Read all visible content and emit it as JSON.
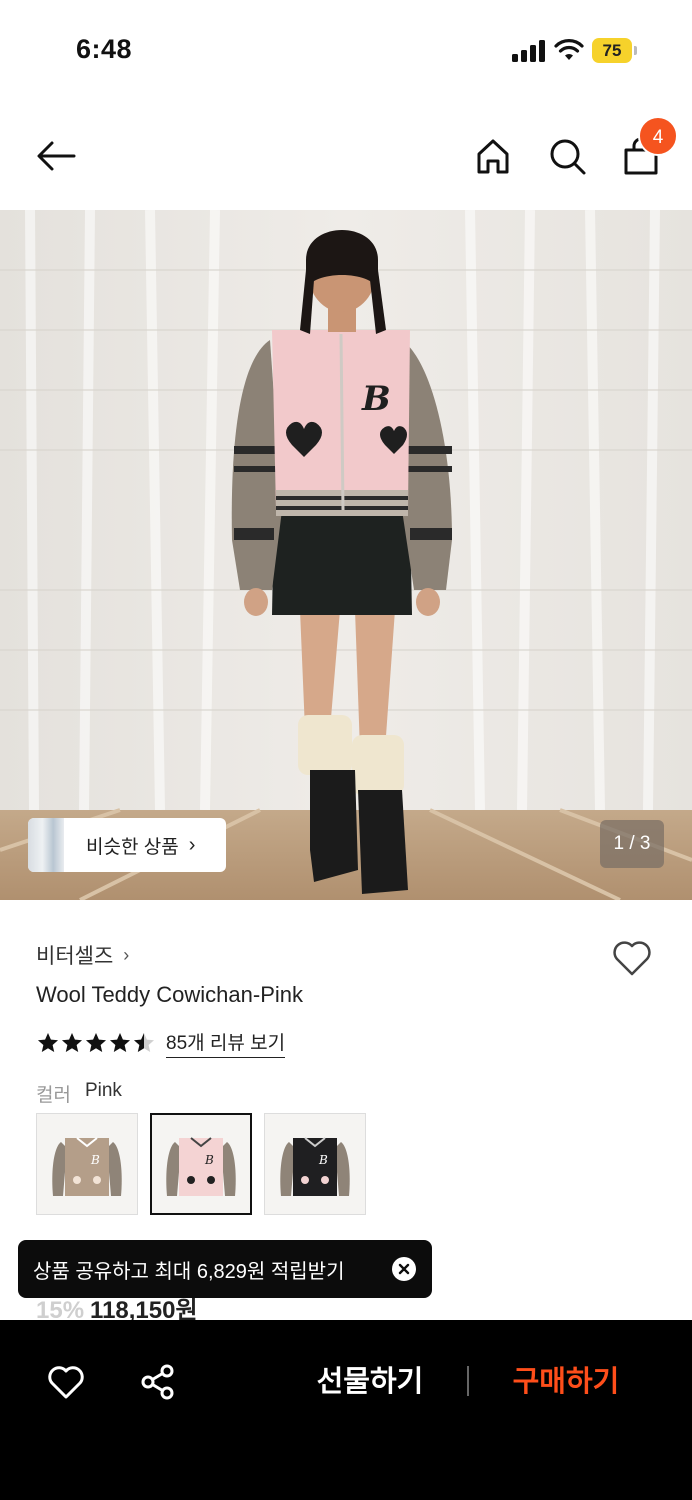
{
  "status_bar": {
    "time": "6:48",
    "battery": "75"
  },
  "header": {
    "cart_count": "4"
  },
  "hero": {
    "similar_label": "비슷한 상품",
    "page_indicator": "1 / 3"
  },
  "product": {
    "brand": "비터셀즈",
    "name": "Wool Teddy Cowichan-Pink",
    "rating": 4.5,
    "review_link": "85개 리뷰 보기",
    "color_label": "컬러",
    "color_value": "Pink",
    "swatches": [
      "beige",
      "pink",
      "black"
    ],
    "selected_swatch": "pink"
  },
  "toast": {
    "text": "상품 공유하고 최대 6,829원 적립받기"
  },
  "price": {
    "discount": "15%",
    "amount": "118,150원"
  },
  "bottom_bar": {
    "gift_label": "선물하기",
    "buy_label": "구매하기"
  },
  "colors": {
    "accent": "#ff4e1a",
    "badge": "#f5541f",
    "battery": "#f6d22b"
  }
}
